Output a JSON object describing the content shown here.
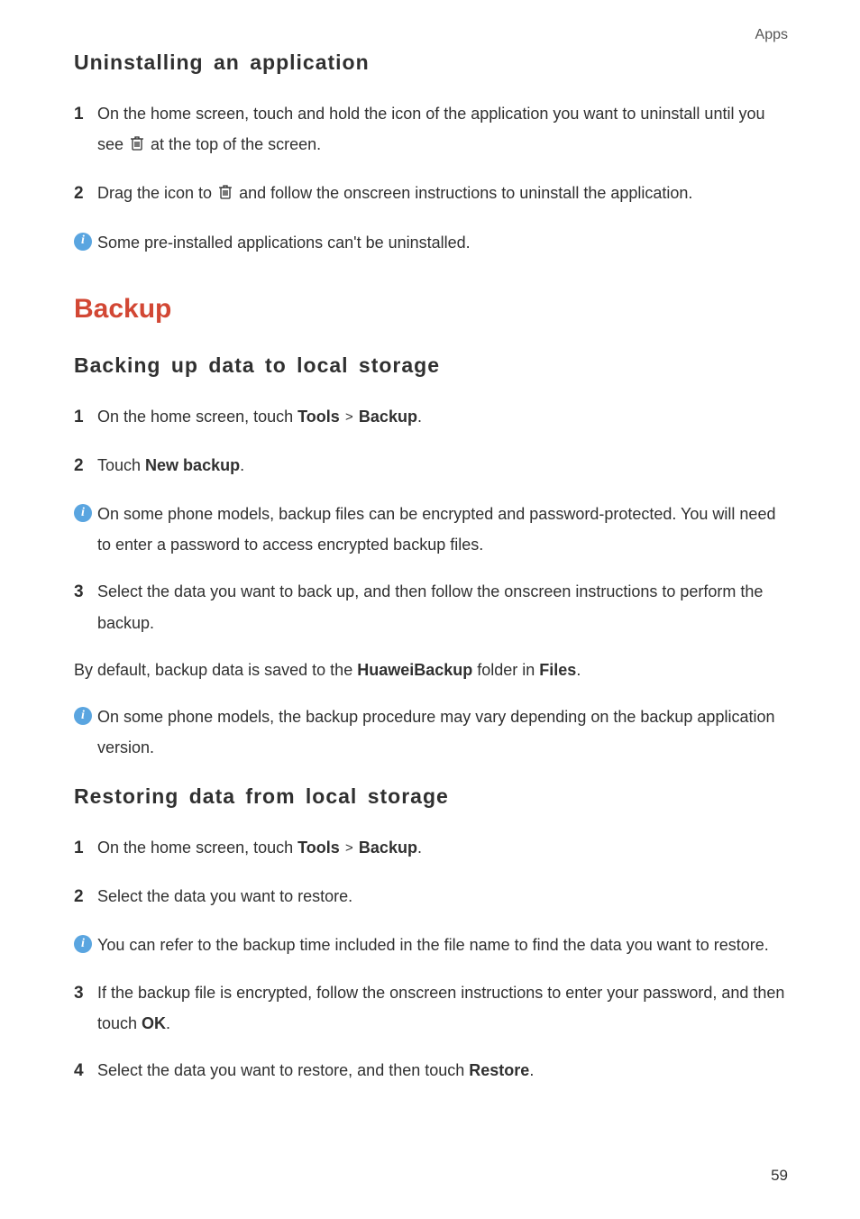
{
  "header": {
    "section": "Apps"
  },
  "uninstall": {
    "heading": "Uninstalling an application",
    "step1_a": "On the home screen, touch and hold the icon of the application you want to uninstall until you see ",
    "step1_b": " at the top of the screen.",
    "step2_a": "Drag the icon to ",
    "step2_b": " and follow the onscreen instructions to uninstall the application.",
    "note": "Some pre-installed applications can't be uninstalled."
  },
  "backup": {
    "title": "Backup",
    "backing_up": {
      "heading": "Backing up data to local storage",
      "step1_a": "On the home screen, touch ",
      "step1_tools": "Tools",
      "step1_backup": "Backup",
      "step1_period": ".",
      "step2_a": "Touch ",
      "step2_new": "New backup",
      "step2_period": ".",
      "note1": "On some phone models, backup files can be encrypted and password-protected. You will need to enter a password to access encrypted backup files.",
      "step3": "Select the data you want to back up, and then follow the onscreen instructions to perform the backup.",
      "default_a": "By default, backup data is saved to the ",
      "default_folder": "HuaweiBackup",
      "default_b": " folder in ",
      "default_files": "Files",
      "default_period": ".",
      "note2": "On some phone models, the backup procedure may vary depending on the backup application version."
    },
    "restoring": {
      "heading": "Restoring data from local storage",
      "step1_a": "On the home screen, touch ",
      "step1_tools": "Tools",
      "step1_backup": "Backup",
      "step1_period": ".",
      "step2": "Select the data you want to restore.",
      "note": "You can refer to the backup time included in the file name to find the data you want to restore.",
      "step3_a": "If the backup file is encrypted, follow the onscreen instructions to enter your password, and then touch ",
      "step3_ok": "OK",
      "step3_period": ".",
      "step4_a": "Select the data you want to restore, and then touch ",
      "step4_restore": "Restore",
      "step4_period": "."
    }
  },
  "page_number": "59"
}
